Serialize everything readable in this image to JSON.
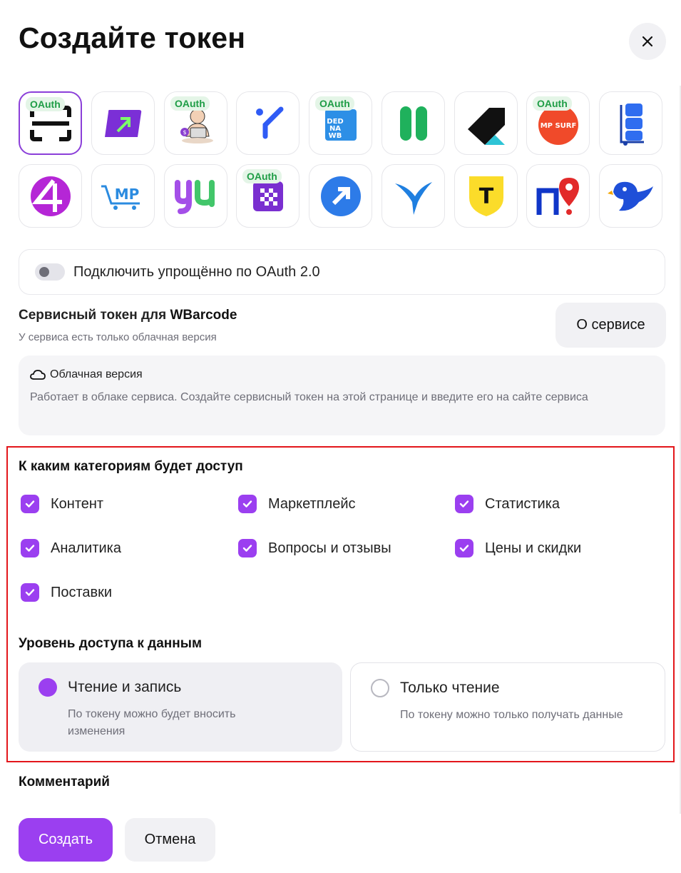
{
  "dialog": {
    "title": "Создайте токен"
  },
  "services": {
    "oauth_badge": "OAuth",
    "tiles": [
      {
        "name": "scanner",
        "oauth": true,
        "selected": true
      },
      {
        "name": "purple-arrow",
        "oauth": false
      },
      {
        "name": "man-with-laptop",
        "oauth": true
      },
      {
        "name": "blue-y",
        "oauth": false
      },
      {
        "name": "ded-na-wb",
        "oauth": true,
        "text": "DED NA WB"
      },
      {
        "name": "green-bars",
        "oauth": false
      },
      {
        "name": "black-arrow",
        "oauth": false
      },
      {
        "name": "mp-surf",
        "oauth": true,
        "text": "MP SURF"
      },
      {
        "name": "blue-cart",
        "oauth": false
      },
      {
        "name": "purple-four",
        "oauth": false
      },
      {
        "name": "mp-cart",
        "oauth": false,
        "text": "MP"
      },
      {
        "name": "yu-logo",
        "oauth": false
      },
      {
        "name": "purple-grid",
        "oauth": true
      },
      {
        "name": "blue-circle-arrow",
        "oauth": false
      },
      {
        "name": "blue-bird-y",
        "oauth": false
      },
      {
        "name": "yellow-shield-t",
        "oauth": false,
        "text": "T"
      },
      {
        "name": "p-pin",
        "oauth": false
      },
      {
        "name": "blue-bird",
        "oauth": false
      }
    ]
  },
  "oauth_toggle": {
    "label": "Подключить упрощённо по OAuth 2.0",
    "enabled": false
  },
  "service_token": {
    "title_prefix": "Сервисный токен для ",
    "service_name": "WBarcode",
    "subtitle": "У сервиса есть только облачная версия",
    "about_button": "О сервисе"
  },
  "cloud": {
    "title": "Облачная версия",
    "description": "Работает в облаке сервиса. Создайте сервисный токен на этой странице и введите его на сайте сервиса"
  },
  "categories": {
    "title": "К каким категориям будет доступ",
    "items": [
      {
        "label": "Контент",
        "checked": true
      },
      {
        "label": "Маркетплейс",
        "checked": true
      },
      {
        "label": "Статистика",
        "checked": true
      },
      {
        "label": "Аналитика",
        "checked": true
      },
      {
        "label": "Вопросы и отзывы",
        "checked": true
      },
      {
        "label": "Цены и скидки",
        "checked": true
      },
      {
        "label": "Поставки",
        "checked": true
      }
    ]
  },
  "access_level": {
    "title": "Уровень доступа к данным",
    "options": [
      {
        "label": "Чтение и запись",
        "description": "По токену можно будет вносить изменения",
        "selected": true
      },
      {
        "label": "Только чтение",
        "description": "По токену можно только получать данные",
        "selected": false
      }
    ]
  },
  "comment": {
    "title": "Комментарий"
  },
  "actions": {
    "create": "Создать",
    "cancel": "Отмена"
  },
  "colors": {
    "accent": "#9b3ff0",
    "highlight_frame": "#e3161b",
    "oauth_badge_bg": "#e4f5e7",
    "oauth_badge_text": "#1f9d46"
  }
}
